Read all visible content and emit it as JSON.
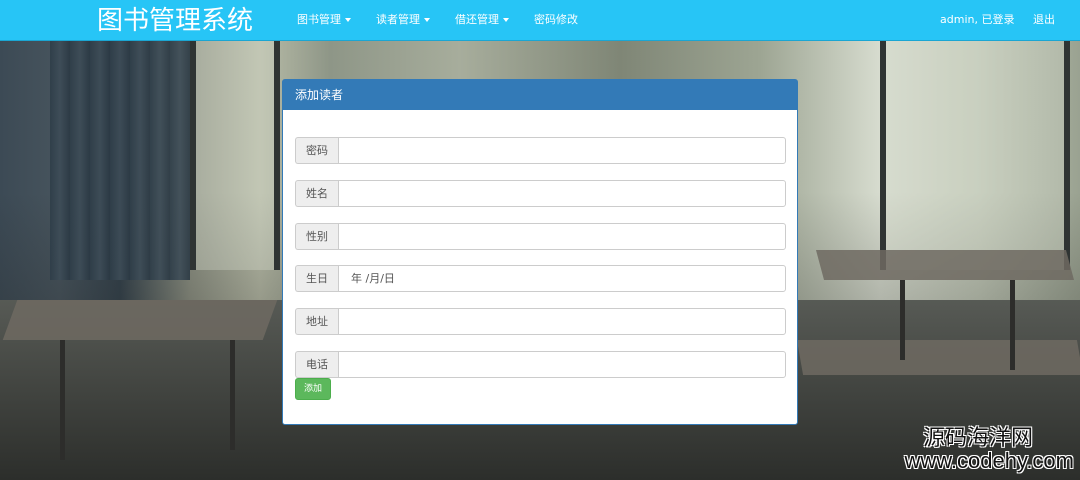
{
  "navbar": {
    "brand": "图书管理系统",
    "items": [
      {
        "label": "图书管理",
        "dropdown": true
      },
      {
        "label": "读者管理",
        "dropdown": true
      },
      {
        "label": "借还管理",
        "dropdown": true
      },
      {
        "label": "密码修改",
        "dropdown": false
      }
    ],
    "user_status": "admin, 已登录",
    "logout": "退出",
    "color": "#27c5f6"
  },
  "panel": {
    "title": "添加读者",
    "header_color": "#337ab7",
    "fields": [
      {
        "label": "密码",
        "value": "",
        "placeholder": ""
      },
      {
        "label": "姓名",
        "value": "",
        "placeholder": ""
      },
      {
        "label": "性别",
        "value": "",
        "placeholder": ""
      },
      {
        "label": "生日",
        "value": "年 /月/日",
        "placeholder": ""
      },
      {
        "label": "地址",
        "value": "",
        "placeholder": ""
      },
      {
        "label": "电话",
        "value": "",
        "placeholder": ""
      }
    ],
    "submit_label": "添加",
    "submit_color": "#5cb85c"
  },
  "watermark": {
    "line1": "源码海洋网",
    "line2": "www.codehy.com"
  }
}
